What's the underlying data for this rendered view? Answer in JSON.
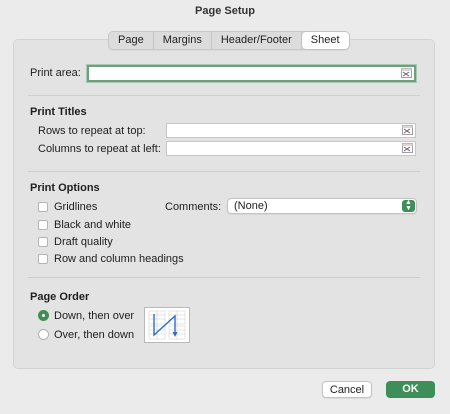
{
  "window": {
    "title": "Page Setup"
  },
  "tabs": [
    {
      "label": "Page"
    },
    {
      "label": "Margins"
    },
    {
      "label": "Header/Footer"
    },
    {
      "label": "Sheet",
      "active": true
    }
  ],
  "print_area": {
    "label": "Print area:",
    "value": ""
  },
  "print_titles": {
    "heading": "Print Titles",
    "rows_label": "Rows to repeat at top:",
    "rows_value": "",
    "cols_label": "Columns to repeat at left:",
    "cols_value": ""
  },
  "print_options": {
    "heading": "Print Options",
    "gridlines": "Gridlines",
    "black_white": "Black and white",
    "draft": "Draft quality",
    "headings": "Row and column headings",
    "comments_label": "Comments:",
    "comments_value": "(None)"
  },
  "page_order": {
    "heading": "Page Order",
    "down_then_over": "Down, then over",
    "over_then_down": "Over, then down",
    "selected": "down_then_over"
  },
  "buttons": {
    "cancel": "Cancel",
    "ok": "OK"
  },
  "colors": {
    "accent": "#3e8e59",
    "focus_ring": "#6f9f7c",
    "arrow_blue": "#2f6fbf"
  }
}
